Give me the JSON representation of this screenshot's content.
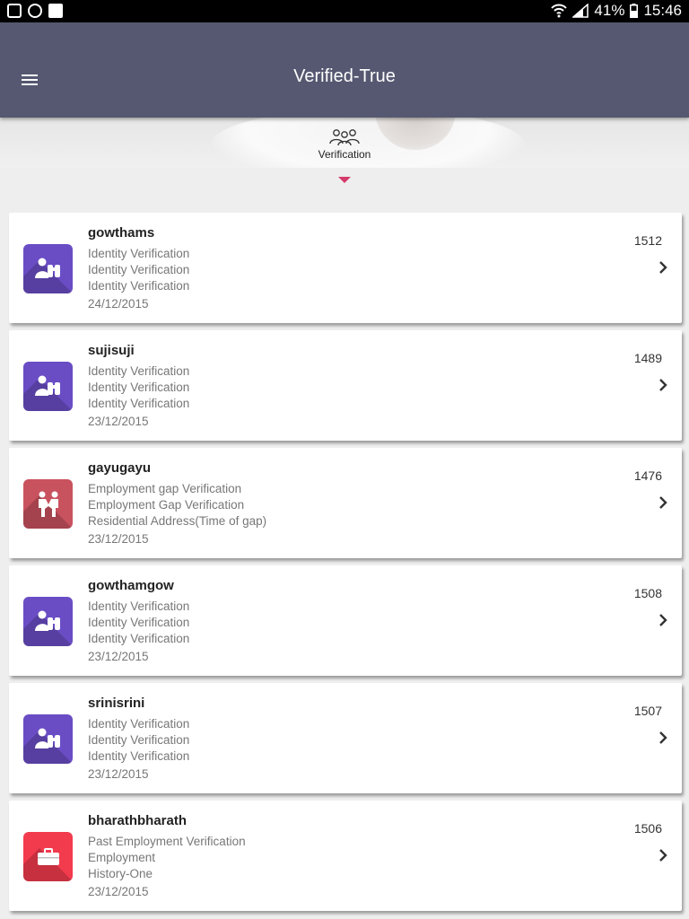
{
  "status_bar": {
    "battery": "41%",
    "time": "15:46",
    "left_icons": [
      "gallery-icon",
      "camera-icon",
      "clipboard-check-icon"
    ],
    "right_icons": [
      "wifi-icon",
      "signal-icon",
      "battery-icon"
    ]
  },
  "app_bar": {
    "title": "Verified-True",
    "menu_icon": "hamburger-menu-icon"
  },
  "tabs": [
    {
      "label": "Verification",
      "icon": "group-people-icon",
      "selected": true
    }
  ],
  "colors": {
    "app_bar": "#555870",
    "tab_indicator": "#d43a6a",
    "identity_icon_bg": "#6a4dc4",
    "employment_gap_icon_bg": "#c9525f",
    "past_employment_icon_bg": "#f23b4d"
  },
  "cards": [
    {
      "name": "gowthams",
      "lines": [
        "Identity Verification",
        "Identity Verification",
        "Identity Verification"
      ],
      "date": "24/12/2015",
      "id": "1512",
      "icon": "binoculars-person-icon",
      "icon_color": "#6a4dc4"
    },
    {
      "name": "sujisuji",
      "lines": [
        "Identity Verification",
        "Identity Verification",
        "Identity Verification"
      ],
      "date": "23/12/2015",
      "id": "1489",
      "icon": "binoculars-person-icon",
      "icon_color": "#6a4dc4"
    },
    {
      "name": "gayugayu",
      "lines": [
        "Employment gap Verification",
        "Employment Gap Verification",
        "Residential Address(Time of gap)"
      ],
      "date": "23/12/2015",
      "id": "1476",
      "icon": "people-handshake-icon",
      "icon_color": "#c9525f"
    },
    {
      "name": "gowthamgow",
      "lines": [
        "Identity Verification",
        "Identity Verification",
        "Identity Verification"
      ],
      "date": "23/12/2015",
      "id": "1508",
      "icon": "binoculars-person-icon",
      "icon_color": "#6a4dc4"
    },
    {
      "name": "srinisrini",
      "lines": [
        "Identity Verification",
        "Identity Verification",
        "Identity Verification"
      ],
      "date": "23/12/2015",
      "id": "1507",
      "icon": "binoculars-person-icon",
      "icon_color": "#6a4dc4"
    },
    {
      "name": "bharathbharath",
      "lines": [
        "Past Employment Verification",
        "Employment",
        "History-One"
      ],
      "date": "23/12/2015",
      "id": "1506",
      "icon": "briefcase-icon",
      "icon_color": "#f23b4d"
    }
  ]
}
